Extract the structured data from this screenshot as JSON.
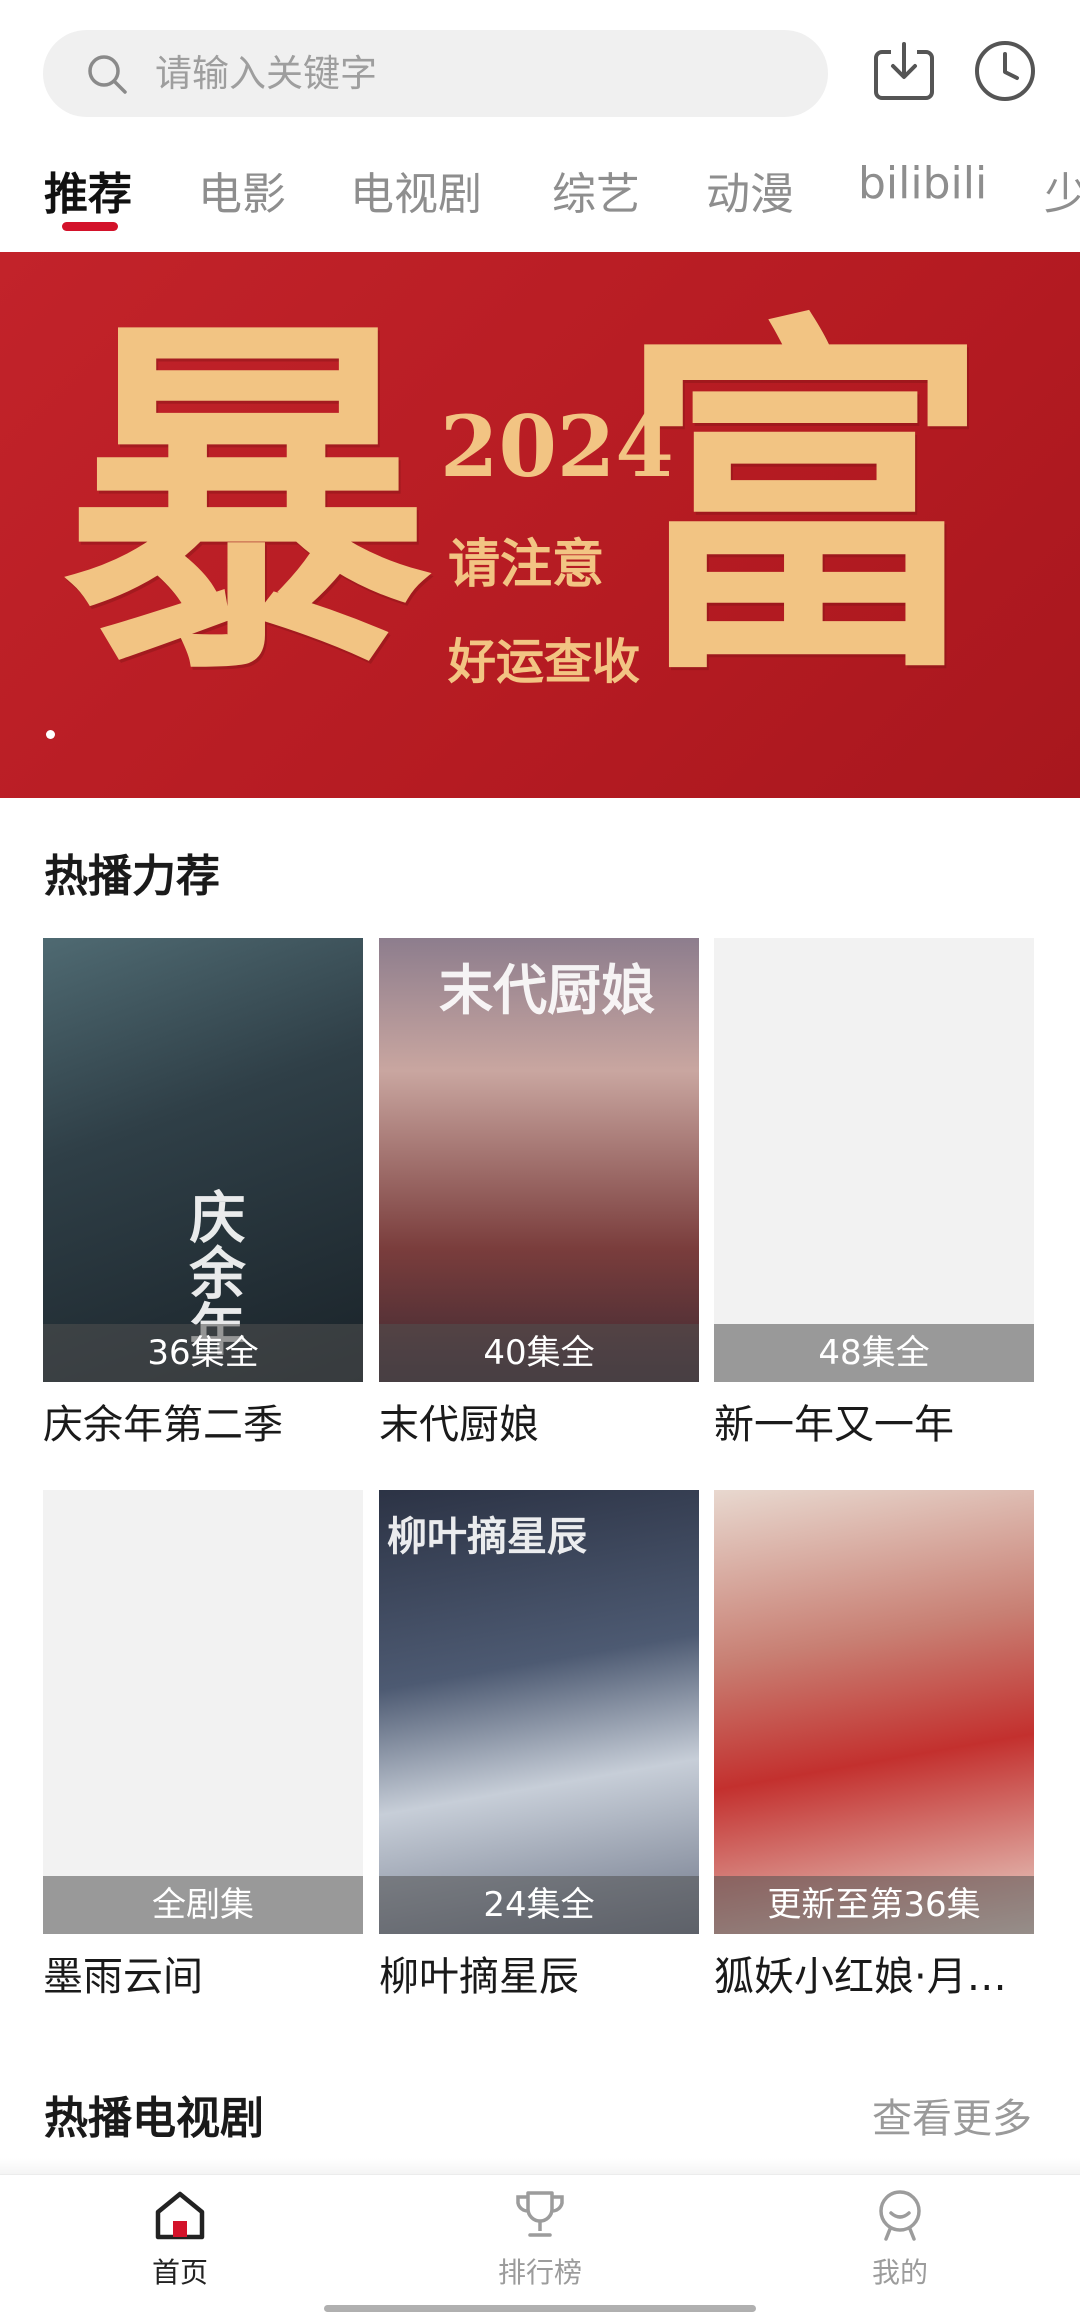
{
  "search": {
    "placeholder": "请输入关键字"
  },
  "header_icons": [
    "download-icon",
    "history-icon"
  ],
  "tabs": [
    {
      "label": "推荐",
      "active": true
    },
    {
      "label": "电影"
    },
    {
      "label": "电视剧"
    },
    {
      "label": "综艺"
    },
    {
      "label": "动漫"
    },
    {
      "label": "bilibili"
    },
    {
      "label": "少"
    }
  ],
  "banner": {
    "big_left": "暴",
    "big_right": "富",
    "year": "2024",
    "line1": "请注意",
    "line2": "好运查收"
  },
  "hot": {
    "title": "热播力荐",
    "items": [
      {
        "title": "庆余年第二季",
        "badge": "36集全",
        "art": "庆余年"
      },
      {
        "title": "末代厨娘",
        "badge": "40集全",
        "art": "末代厨娘"
      },
      {
        "title": "新一年又一年",
        "badge": "48集全"
      },
      {
        "title": "墨雨云间",
        "badge": "全剧集"
      },
      {
        "title": "柳叶摘星辰",
        "badge": "24集全",
        "art": "柳叶摘星辰"
      },
      {
        "title": "狐妖小红娘·月红篇",
        "badge": "更新至第36集"
      }
    ]
  },
  "tv_section": {
    "title": "热播电视剧",
    "more": "查看更多"
  },
  "bottom_nav": [
    {
      "label": "首页",
      "active": true
    },
    {
      "label": "排行榜"
    },
    {
      "label": "我的"
    }
  ],
  "colors": {
    "accent": "#d3122a",
    "banner_bg": "#c2232a",
    "banner_gold": "#f2c483"
  }
}
